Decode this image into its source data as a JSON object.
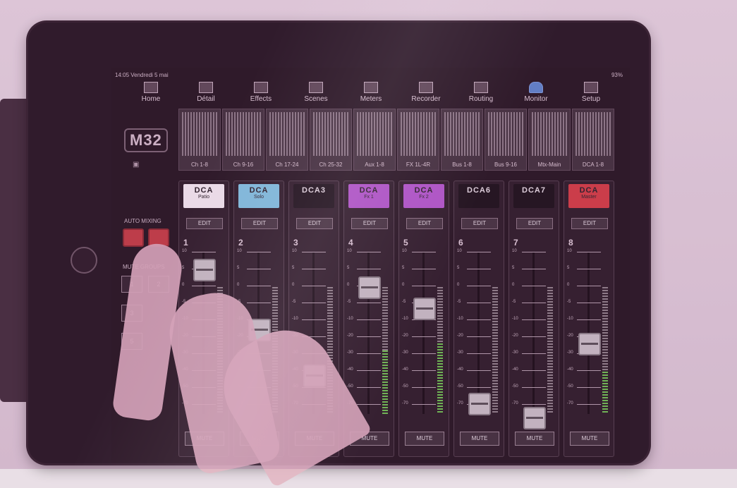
{
  "status_bar": {
    "time_date": "14:05 Vendredi 5 mai",
    "battery": "93%"
  },
  "nav": [
    {
      "label": "Home",
      "icon": "home-icon"
    },
    {
      "label": "Détail",
      "icon": "detail-icon"
    },
    {
      "label": "Effects",
      "icon": "effects-icon"
    },
    {
      "label": "Scenes",
      "icon": "scenes-icon"
    },
    {
      "label": "Meters",
      "icon": "meters-icon"
    },
    {
      "label": "Recorder",
      "icon": "recorder-icon"
    },
    {
      "label": "Routing",
      "icon": "routing-icon"
    },
    {
      "label": "Monitor",
      "icon": "monitor-icon"
    },
    {
      "label": "Setup",
      "icon": "setup-icon"
    }
  ],
  "sidebar": {
    "logo": "M32",
    "auto_mixing": "AUTO MIXING",
    "mute_groups": "MUTE GROUPS",
    "mute_group_buttons": [
      "1",
      "2",
      "3",
      "5"
    ]
  },
  "meter_banks": [
    "Ch 1-8",
    "Ch 9-16",
    "Ch 17-24",
    "Ch 25-32",
    "Aux 1-8",
    "FX 1L-4R",
    "Bus 1-8",
    "Bus 9-16",
    "Mtx-Main",
    "DCA 1-8"
  ],
  "strips": [
    {
      "scribble": "DCA",
      "name": "Patio",
      "number": "1",
      "edit": "EDIT",
      "mute": "MUTE",
      "color": "#ffffff"
    },
    {
      "scribble": "DCA",
      "name": "Solo",
      "number": "2",
      "edit": "EDIT",
      "mute": "MUTE",
      "color": "#7fd3ee"
    },
    {
      "scribble": "DCA3",
      "name": "",
      "number": "3",
      "edit": "EDIT",
      "mute": "MUTE",
      "color": "#111111"
    },
    {
      "scribble": "DCA",
      "name": "Fx 1",
      "number": "4",
      "edit": "EDIT",
      "mute": "MUTE",
      "color": "#b65cd6"
    },
    {
      "scribble": "DCA",
      "name": "Fx 2",
      "number": "5",
      "edit": "EDIT",
      "mute": "MUTE",
      "color": "#b65cd6"
    },
    {
      "scribble": "DCA6",
      "name": "",
      "number": "6",
      "edit": "EDIT",
      "mute": "MUTE",
      "color": "#111111"
    },
    {
      "scribble": "DCA7",
      "name": "",
      "number": "7",
      "edit": "EDIT",
      "mute": "MUTE",
      "color": "#111111"
    },
    {
      "scribble": "DCA",
      "name": "Master",
      "number": "8",
      "edit": "EDIT",
      "mute": "MUTE",
      "color": "#d94040"
    }
  ],
  "scale_marks": [
    "10",
    "5",
    "0",
    "-5",
    "-10",
    "-20",
    "-30",
    "-40",
    "-50",
    "-70"
  ]
}
